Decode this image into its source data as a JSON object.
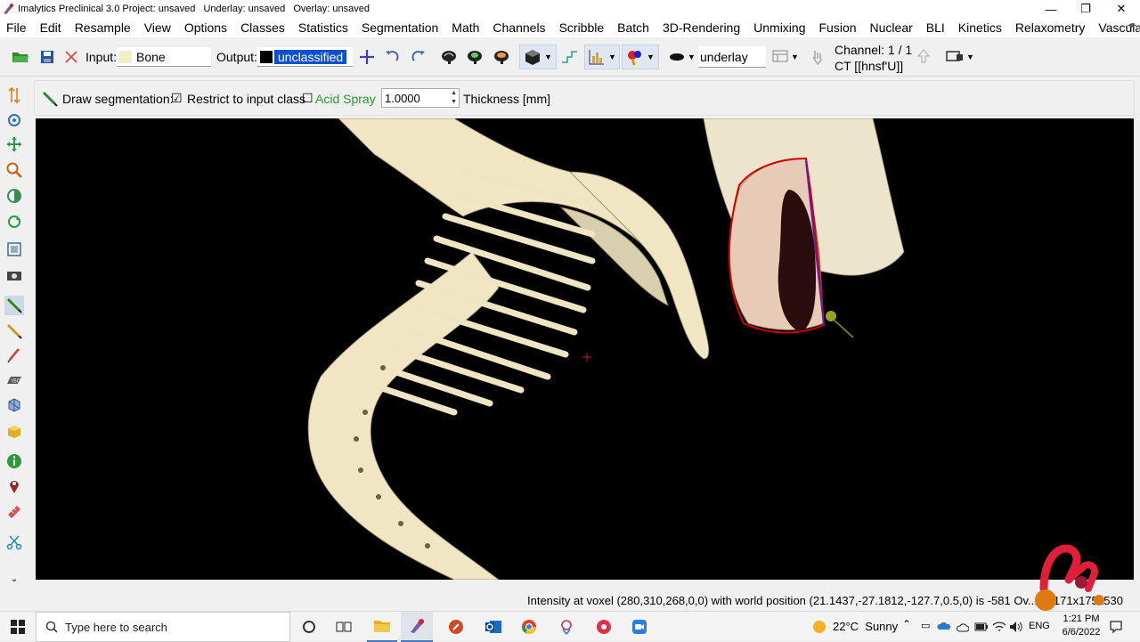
{
  "window": {
    "title": "Imalytics Preclinical 3.0 Project: unsaved   Underlay: unsaved   Overlay: unsaved",
    "minimize": "—",
    "restore": "❐",
    "close": "✕"
  },
  "menu": {
    "items": [
      "File",
      "Edit",
      "Resample",
      "View",
      "Options",
      "Classes",
      "Statistics",
      "Segmentation",
      "Math",
      "Channels",
      "Scribble",
      "Batch",
      "3D-Rendering",
      "Unmixing",
      "Fusion",
      "Nuclear",
      "BLI",
      "Kinetics",
      "Relaxometry",
      "Vascular"
    ]
  },
  "toolbar": {
    "input_label": "Input:",
    "input_value": "Bone",
    "output_label": "Output:",
    "output_value": "unclassified",
    "underlay_value": "underlay",
    "channel_label": "Channel: 1 / 1",
    "channel_name": "CT [[hnsf'U]]"
  },
  "segmentation": {
    "draw_label": "Draw segmentation:",
    "restrict_label": "Restrict to input class",
    "restrict_checked": "☑",
    "acid_label": "Acid Spray",
    "acid_checked": "☐",
    "thickness_value": "1.0000",
    "thickness_label": "Thickness [mm]"
  },
  "status": {
    "text": "Intensity at voxel (280,310,268,0,0) with world position (21.1437,-27.1812,-127.7,0.5,0) is -581 Ov... 0  171x175x530"
  },
  "taskbar": {
    "search_placeholder": "Type here to search",
    "weather": "22°C  Sunny",
    "language": "ENG",
    "time": "1:21 PM",
    "date": "6/6/2022"
  },
  "colors": {
    "bone": "#f0e6c4",
    "selection": "#0a50d0",
    "roi_outline": "#d00000",
    "accent_green": "#2a9a2a"
  }
}
